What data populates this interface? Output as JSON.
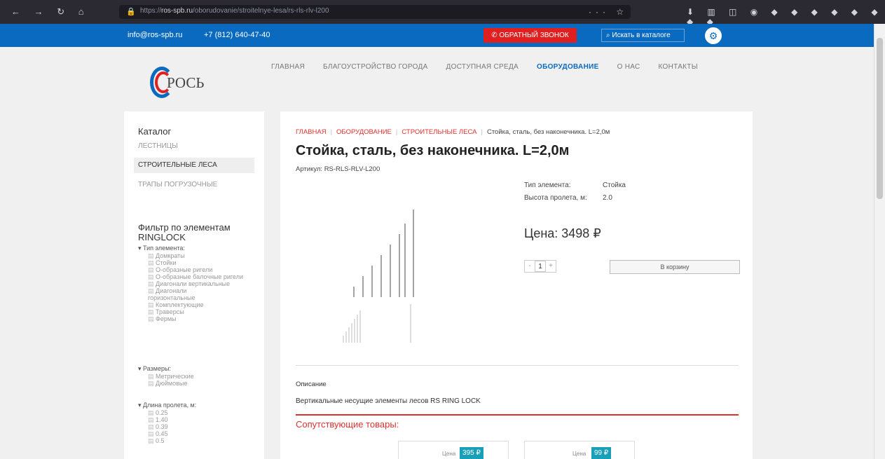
{
  "browser": {
    "url_prefix": "https://",
    "url_host": "ros-spb.ru",
    "url_path": "/oborudovanie/stroitelnye-lesa/rs-rls-rlv-l200"
  },
  "topbar": {
    "email": "info@ros-spb.ru",
    "phone": "+7 (812) 640-47-40",
    "callback": "ОБРАТНЫЙ ЗВОНОК",
    "search_placeholder": "Искать в каталоге"
  },
  "logo": {
    "text": "РОСЬ"
  },
  "menu": [
    "ГЛАВНАЯ",
    "БЛАГОУСТРОЙСТВО ГОРОДА",
    "ДОСТУПНАЯ СРЕДА",
    "ОБОРУДОВАНИЕ",
    "О НАС",
    "КОНТАКТЫ"
  ],
  "sidebar": {
    "catalog_title": "Каталог",
    "categories": [
      "ЛЕСТНИЦЫ",
      "СТРОИТЕЛЬНЫЕ ЛЕСА",
      "ТРАПЫ ПОГРУЗОЧНЫЕ"
    ],
    "filter_title": "Фильтр по элементам RINGLOCK",
    "groups": [
      {
        "title": "Тип элемента:",
        "options": [
          "Домкраты",
          "Стойки",
          "О-образные ригели",
          "О-образные балочные ригели",
          "Диагонали вертикальные",
          "Диагонали горизонтальные",
          "Комплектующие",
          "Траверсы",
          "Фермы"
        ]
      },
      {
        "title": "Размеры:",
        "options": [
          "Метрические",
          "Дюймовые"
        ]
      },
      {
        "title": "Длина пролета, м:",
        "options": [
          "0.25",
          "1.40",
          "0.39",
          "0.45",
          "0.5"
        ]
      }
    ]
  },
  "product": {
    "breadcrumb": [
      "ГЛАВНАЯ",
      "ОБОРУДОВАНИЕ",
      "СТРОИТЕЛЬНЫЕ ЛЕСА",
      "Стойка, сталь, без наконечника. L=2,0м"
    ],
    "title": "Стойка, сталь, без наконечника. L=2,0м",
    "sku": "Артикул: RS-RLS-RLV-L200",
    "specs": [
      {
        "k": "Тип элемента:",
        "v": "Стойка"
      },
      {
        "k": "Высота пролета, м:",
        "v": "2.0"
      }
    ],
    "price": "Цена: 3498 ₽",
    "qty": "1",
    "cart": "В корзину",
    "desc_title": "Описание",
    "desc": "Вертикальные несущие элементы лесов RS RING LOCK",
    "related_title": "Сопутствующие товары:",
    "related": [
      {
        "label": "Цена",
        "price": "395 ₽"
      },
      {
        "label": "Цена",
        "price": "99 ₽"
      }
    ]
  }
}
